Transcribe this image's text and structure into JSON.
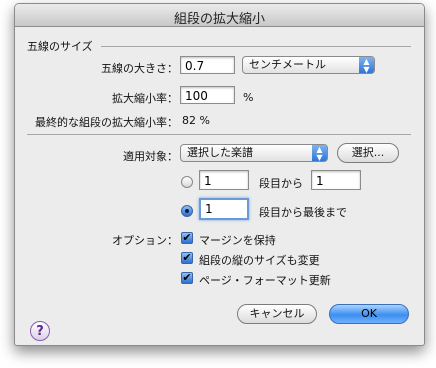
{
  "window": {
    "title": "組段の拡大縮小"
  },
  "staff_size": {
    "section_label": "五線のサイズ",
    "size_label": "五線の大きさ：",
    "size_value": "0.7",
    "unit_selected": "センチメートル",
    "scale_label": "拡大縮小率：",
    "scale_value": "100",
    "scale_unit": "%",
    "final_label": "最終的な組段の拡大縮小率：",
    "final_value": "82 %"
  },
  "apply": {
    "label": "適用対象：",
    "target_selected": "選択した楽譜",
    "select_button": "選択...",
    "range1_from": "1",
    "range1_mid": "段目から",
    "range1_to": "1",
    "range2_from": "1",
    "range2_suffix": "段目から最後まで"
  },
  "options": {
    "label": "オプション：",
    "items": [
      {
        "label": "マージンを保持",
        "checked": true
      },
      {
        "label": "組段の縦のサイズも変更",
        "checked": true
      },
      {
        "label": "ページ・フォーマット更新",
        "checked": true
      }
    ]
  },
  "buttons": {
    "cancel": "キャンセル",
    "ok": "OK",
    "help": "?"
  },
  "icons": {
    "popup_arrows": "up-down-arrows-icon",
    "checkmark": "checkmark-icon",
    "help": "question-icon"
  }
}
